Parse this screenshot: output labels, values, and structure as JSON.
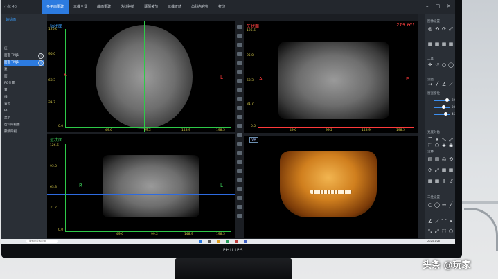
{
  "app": {
    "brand": "小花 40"
  },
  "menu": {
    "items": [
      {
        "label": "多平面重建",
        "active": true
      },
      {
        "label": "三维全景",
        "active": false
      },
      {
        "label": "曲面重建",
        "active": false
      },
      {
        "label": "齿科种植",
        "active": false
      },
      {
        "label": "颞颌关节",
        "active": false
      },
      {
        "label": "三维正畸",
        "active": false
      },
      {
        "label": "齿科内容物",
        "active": false
      },
      {
        "label": "打印",
        "active": false
      }
    ]
  },
  "left_panel": {
    "header": "轴状面",
    "items": [
      {
        "label": "应",
        "active": false,
        "badge": ""
      },
      {
        "label": "面面 TMJ1",
        "active": false,
        "badge": "i"
      },
      {
        "label": "面面 TMJ1",
        "active": true,
        "badge": "i"
      },
      {
        "label": "复",
        "active": false,
        "badge": ""
      },
      {
        "label": "面",
        "active": false,
        "badge": ""
      },
      {
        "label": "PG位置",
        "active": false,
        "badge": ""
      },
      {
        "label": "置",
        "active": false,
        "badge": ""
      },
      {
        "label": "线",
        "active": false,
        "badge": ""
      },
      {
        "label": "置位",
        "active": false,
        "badge": ""
      },
      {
        "label": "PG",
        "active": false,
        "badge": ""
      },
      {
        "label": "显示",
        "active": false,
        "badge": ""
      },
      {
        "label": "齿科四视图",
        "active": false,
        "badge": ""
      },
      {
        "label": "颞颌四视",
        "active": false,
        "badge": ""
      }
    ]
  },
  "views": {
    "axial": {
      "label": "轴状面",
      "y_ticks": [
        "126.6",
        "95.0",
        "63.3",
        "31.7",
        "0.0"
      ],
      "x_ticks": [
        "49.6",
        "99.2",
        "148.9",
        "198.5"
      ],
      "left_dir": "R",
      "right_dir": "L"
    },
    "sagittal": {
      "label": "矢状面",
      "hu": "219 HU",
      "y_ticks": [
        "126.6",
        "95.0",
        "63.3",
        "31.7",
        "0.0"
      ],
      "x_ticks": [
        "49.6",
        "99.2",
        "148.9",
        "198.5"
      ],
      "left_dir": "A",
      "right_dir": "P"
    },
    "coronal": {
      "label": "冠状面",
      "y_ticks": [
        "126.6",
        "95.0",
        "63.3",
        "31.7",
        "0.0"
      ],
      "x_ticks": [
        "49.6",
        "99.2",
        "148.9",
        "198.5"
      ],
      "left_dir": "R",
      "right_dir": "L"
    },
    "volume": {
      "tag": "VR"
    }
  },
  "right_panel": {
    "sections": [
      "图像设置",
      "工具",
      "测量",
      "窗宽窗位",
      "亮度对比",
      "注释",
      "三维设置"
    ],
    "sliders": [
      {
        "value": "22",
        "fill": 0.8
      },
      {
        "value": "30",
        "fill": 0.6
      },
      {
        "value": "45",
        "fill": 0.7
      }
    ]
  },
  "taskbar": {
    "search_placeholder": "搜索图片和应用",
    "time": "2024/1/28"
  },
  "bezel": {
    "brand": "PHILIPS"
  },
  "watermark": "头条 @玩家",
  "colors": {
    "accent": "#2c7be0",
    "tick": "#d4c84a",
    "axis_blue": "#2e6be0",
    "ruler_green": "#2ec948",
    "dir_red": "#ff3a3a"
  }
}
